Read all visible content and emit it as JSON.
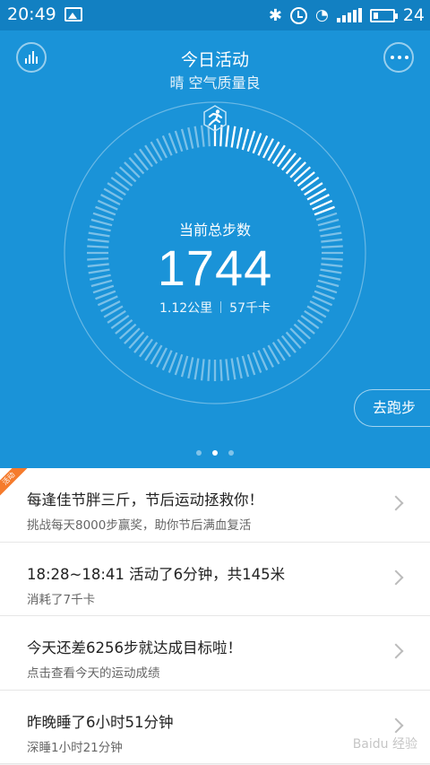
{
  "status_bar": {
    "time": "20:49",
    "battery_level": "24",
    "battery_fraction": 0.24,
    "icons": [
      "image-icon",
      "bluetooth-icon",
      "alarm-icon",
      "wifi-icon",
      "signal-icon",
      "battery-icon"
    ]
  },
  "header": {
    "title": "今日活动",
    "subtitle": "晴 空气质量良",
    "left_icon": "stats-icon",
    "right_icon": "more-icon"
  },
  "dial": {
    "label": "当前总步数",
    "steps": "1744",
    "distance": "1.12公里",
    "calories": "57千卡",
    "progress": 0.2,
    "accent_color": "#1a93d8"
  },
  "run_button": {
    "label": "去跑步"
  },
  "pager": {
    "count": 3,
    "active": 1
  },
  "list": [
    {
      "badge": "活动",
      "title": "每逢佳节胖三斤，节后运动拯救你！",
      "sub": "挑战每天8000步赢奖，助你节后满血复活"
    },
    {
      "title": "18:28~18:41 活动了6分钟，共145米",
      "sub": "消耗了7千卡"
    },
    {
      "title": "今天还差6256步就达成目标啦！",
      "sub": "点击查看今天的运动成绩"
    },
    {
      "title": "昨晚睡了6小时51分钟",
      "sub": "深睡1小时21分钟"
    }
  ],
  "watermark": "Baidu 经验"
}
